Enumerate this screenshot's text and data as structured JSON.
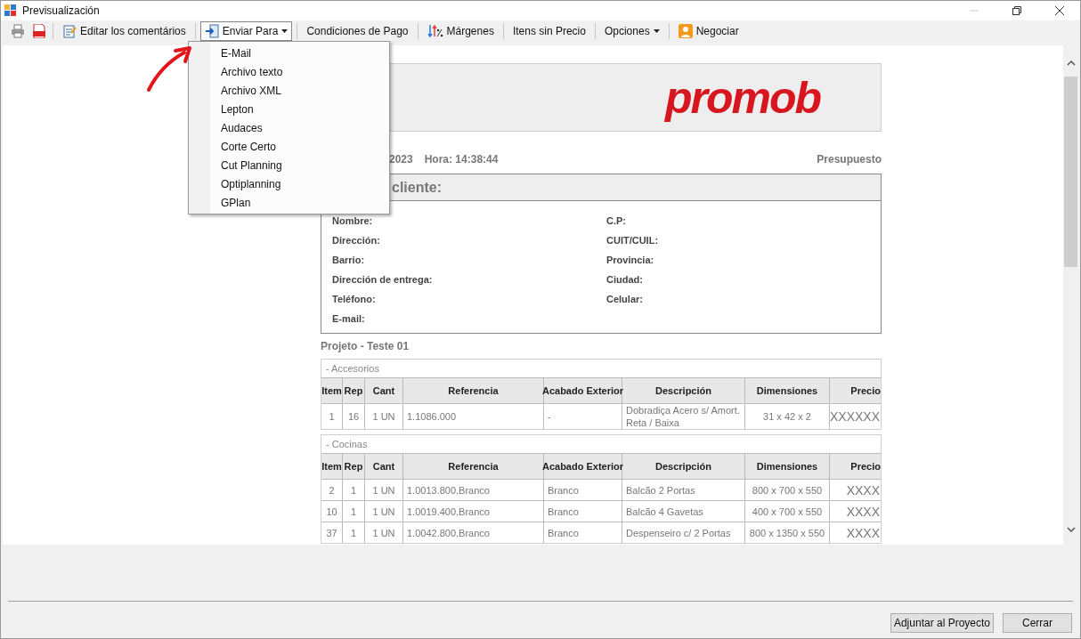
{
  "window": {
    "title": "Previsualización"
  },
  "toolbar": [
    [
      {
        "kind": "print"
      },
      {
        "kind": "pdf"
      }
    ],
    [
      {
        "kind": "notes",
        "label": "Editar los comentários"
      }
    ],
    [
      {
        "kind": "send",
        "label": "Enviar Para",
        "expanded": true
      }
    ],
    [
      {
        "kind": "text",
        "label": "Condiciones de Pago"
      }
    ],
    [
      {
        "kind": "margins",
        "label": "Márgenes"
      }
    ],
    [
      {
        "kind": "text",
        "label": "Itens sin Precio"
      }
    ],
    [
      {
        "kind": "menu",
        "label": "Opciones",
        "expanded": false
      }
    ],
    [
      {
        "kind": "person",
        "label": "Negociar"
      }
    ]
  ],
  "send_menu": [
    "E-Mail",
    "Archivo texto",
    "Archivo XML",
    "Lepton",
    "Audaces",
    "Corte Certo",
    "Cut Planning",
    "Optiplanning",
    "GPlan"
  ],
  "report": {
    "logo": "promob",
    "date": "2023",
    "time": "Hora: 14:38:44",
    "doc_type": "Presupuesto",
    "client_title": "cliente:",
    "fields_left": [
      "Nombre:",
      "Dirección:",
      "Barrio:",
      "Dirección de entrega:",
      "Teléfono:",
      "E-mail:"
    ],
    "fields_right": [
      "C.P:",
      "CUIT/CUIL:",
      "Provincia:",
      "Ciudad:",
      "Celular:"
    ],
    "project": "Projeto - Teste 01",
    "sections": [
      {
        "title": "- Accesorios",
        "columns": [
          "Item",
          "Rep",
          "Cant",
          "Referencia",
          "Acabado Exterior",
          "Descripción",
          "Dimensiones",
          "Precio"
        ],
        "rows": [
          [
            "1",
            "16",
            "1 UN",
            "1.1086.000",
            "-",
            "Dobradiça Acero s/ Amort. Reta / Baixa",
            "31 x 42 x 2",
            "XXXXXX"
          ]
        ]
      },
      {
        "title": "- Cocinas",
        "columns": [
          "Item",
          "Rep",
          "Cant",
          "Referencia",
          "Acabado Exterior",
          "Descripción",
          "Dimensiones",
          "Precio"
        ],
        "rows": [
          [
            "2",
            "1",
            "1 UN",
            "1.0013.800.Branco",
            "Branco",
            "Balcão 2 Portas",
            "800 x 700 x 550",
            "XXXX"
          ],
          [
            "10",
            "1",
            "1 UN",
            "1.0019.400.Branco",
            "Branco",
            "Balcão 4 Gavetas",
            "400 x 700 x 550",
            "XXXX"
          ],
          [
            "37",
            "1",
            "1 UN",
            "1.0042.800.Branco",
            "Branco",
            "Despenseiro c/ 2 Portas",
            "800 x 1350 x 550",
            "XXXX"
          ]
        ]
      }
    ]
  },
  "buttons": [
    "Adjuntar al Proyecto",
    "Cerrar"
  ]
}
